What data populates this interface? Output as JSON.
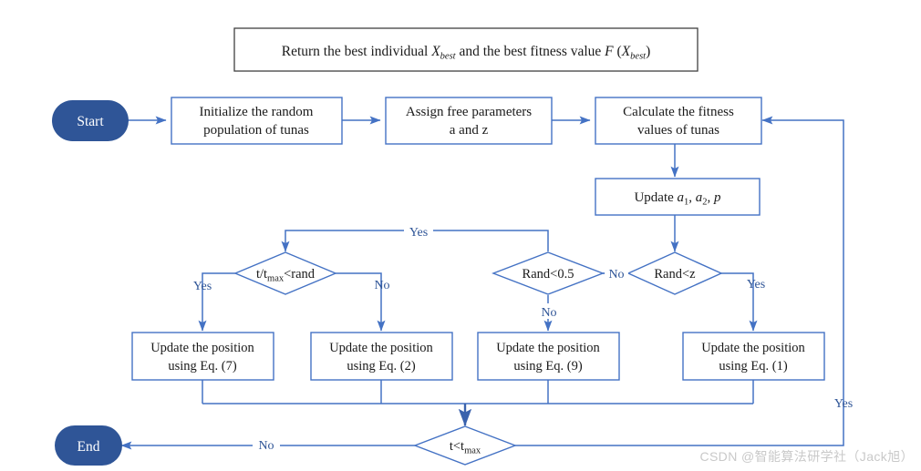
{
  "diagram": {
    "title_box": {
      "text_parts": [
        "Return the best individual ",
        "X",
        "best",
        " and the best fitness value ",
        "F",
        " (",
        "X",
        "best",
        ")"
      ],
      "full_text": "Return the best individual X_best and the best fitness value F (X_best)"
    },
    "colors": {
      "node_border": "#4472c4",
      "node_fill": "#ffffff",
      "terminator_fill": "#2f5597",
      "terminator_text": "#ffffff",
      "edge": "#4472c4",
      "edge_label": "#2f5597",
      "text": "#1a1a1a",
      "legend_border": "#404040",
      "watermark": "#c9c9c9"
    },
    "nodes": {
      "start": {
        "label": "Start",
        "shape": "terminator"
      },
      "init": {
        "line1": "Initialize the random",
        "line2": "population of tunas",
        "shape": "process"
      },
      "assign": {
        "line1": "Assign free parameters",
        "line2": "a and z",
        "shape": "process"
      },
      "calculate": {
        "line1": "Calculate the fitness",
        "line2": "values of tunas",
        "shape": "process"
      },
      "update_params": {
        "prefix": "Update ",
        "v1": "a",
        "s1": "1",
        "sep1": ", ",
        "v2": "a",
        "s2": "2",
        "sep2": ", ",
        "v3": "p",
        "shape": "process"
      },
      "dec_randz": {
        "label": "Rand<z",
        "shape": "decision"
      },
      "dec_rand05": {
        "label": "Rand<0.5",
        "shape": "decision"
      },
      "dec_ttmax_rand": {
        "pre": "t/t",
        "sub": "max",
        "post": "<rand",
        "shape": "decision"
      },
      "dec_t_lt_tmax": {
        "pre": "t<t",
        "sub": "max",
        "shape": "decision"
      },
      "eq7": {
        "line1": "Update the position",
        "line2": "using Eq. (7)",
        "shape": "process"
      },
      "eq2": {
        "line1": "Update the position",
        "line2": "using Eq. (2)",
        "shape": "process"
      },
      "eq9": {
        "line1": "Update the position",
        "line2": "using Eq. (9)",
        "shape": "process"
      },
      "eq1": {
        "line1": "Update the position",
        "line2": "using Eq. (1)",
        "shape": "process"
      },
      "end": {
        "label": "End",
        "shape": "terminator"
      }
    },
    "edge_labels": {
      "randz_yes": "Yes",
      "randz_no": "No",
      "rand05_no": "No",
      "rand05_yes_branch": "Yes",
      "ttmax_yes": "Yes",
      "ttmax_no": "No",
      "loop_yes": "Yes",
      "t_no": "No"
    },
    "watermark": "CSDN @智能算法研学社（Jack旭）"
  }
}
